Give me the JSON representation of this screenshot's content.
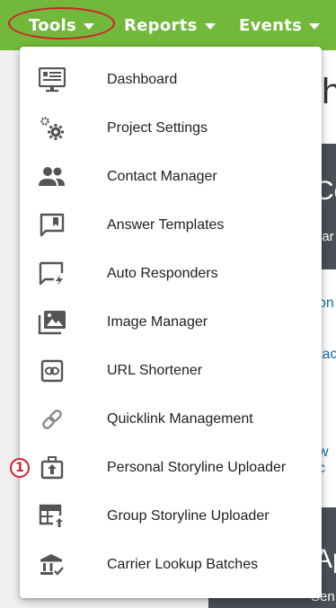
{
  "nav": {
    "items": [
      {
        "label": "Tools"
      },
      {
        "label": "Reports"
      },
      {
        "label": "Events"
      }
    ]
  },
  "background": {
    "heading": "h",
    "card1_title": "Co",
    "card1_sub": "nar",
    "link1": "on",
    "link2": "tac",
    "link3": "w c",
    "card2_title": "Ap",
    "card2_sub": "Sen"
  },
  "menu": {
    "items": [
      {
        "label": "Dashboard",
        "icon": "dashboard-icon"
      },
      {
        "label": "Project Settings",
        "icon": "settings-cogs-icon"
      },
      {
        "label": "Contact Manager",
        "icon": "people-icon"
      },
      {
        "label": "Answer Templates",
        "icon": "bookmark-chat-icon"
      },
      {
        "label": "Auto Responders",
        "icon": "auto-reply-chat-icon"
      },
      {
        "label": "Image Manager",
        "icon": "image-library-icon"
      },
      {
        "label": "URL Shortener",
        "icon": "link-box-icon"
      },
      {
        "label": "Quicklink Management",
        "icon": "link-icon"
      },
      {
        "label": "Personal Storyline Uploader",
        "icon": "upload-box-icon"
      },
      {
        "label": "Group Storyline Uploader",
        "icon": "table-upload-icon"
      },
      {
        "label": "Carrier Lookup Batches",
        "icon": "bank-check-icon"
      }
    ]
  },
  "annotation": {
    "badge": "1"
  },
  "colors": {
    "nav": "#72b83a",
    "highlight": "#d3202a",
    "icon": "#555555"
  }
}
